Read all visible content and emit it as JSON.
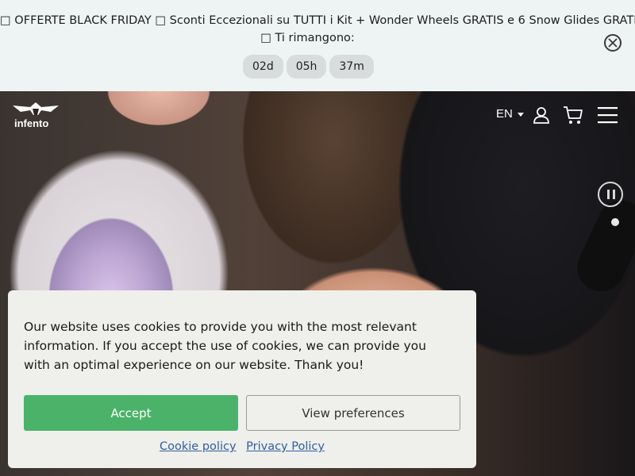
{
  "promo": {
    "line1": "□ OFFERTE BLACK FRIDAY □ Sconti Eccezionali su TUTTI i Kit + Wonder Wheels GRATIS e 6 Snow Glides GRATIS!",
    "line2": "□ Ti rimangono:",
    "timer": {
      "days": "02d",
      "hours": "05h",
      "minutes": "37m"
    },
    "close_icon": "close-circle-icon"
  },
  "header": {
    "logo_text": "infento",
    "language": "EN",
    "icons": [
      "user-icon",
      "cart-icon",
      "menu-icon"
    ]
  },
  "hero": {
    "pause_icon": "pause-icon"
  },
  "cookie": {
    "message": "Our website uses cookies to provide you with the most relevant information. If you accept the use of cookies, we can provide you with an optimal experience on our website. Thank you!",
    "accept_label": "Accept",
    "preferences_label": "View preferences",
    "cookie_policy_label": "Cookie policy",
    "privacy_policy_label": "Privacy Policy",
    "accent_color": "#4bb26a"
  }
}
